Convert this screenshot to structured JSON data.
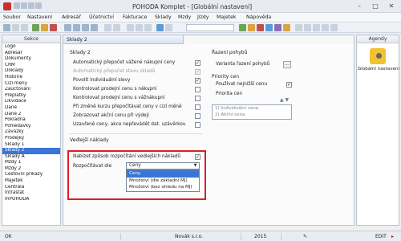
{
  "window": {
    "title": "POHODA Komplet - [Globální nastavení]",
    "buttons": [
      "–",
      "□",
      "✕"
    ]
  },
  "menu": [
    "Soubor",
    "Nastavení",
    "Adresář",
    "Účetnictví",
    "Fakturace",
    "Sklady",
    "Mzdy",
    "Jízdy",
    "Majetek",
    "Nápověda"
  ],
  "sidebar": {
    "header": "Sekce",
    "items": [
      "Logo",
      "Adresář",
      "Dokumenty",
      "CRM",
      "Doklady",
      "Historie",
      "Cizí měny",
      "Zaúčtování",
      "Přeplatky",
      "Likvidace",
      "Daně",
      "Daně 2",
      "Pokladna",
      "Pohledávky",
      "Závazky",
      "Prodejky",
      "Sklady 1",
      "Sklady 2",
      "Sklady A",
      "Mzdy 1",
      "Mzdy 2",
      "Cestovní příkazy",
      "Majetek",
      "Centrála",
      "Intrastat",
      "mPOHODA"
    ],
    "selected": "Sklady 2"
  },
  "main": {
    "tab_label": "Sklady 2",
    "section_sklady": "Sklady 2",
    "left_options": [
      {
        "label": "Automatický přepočet vážené nákupní ceny",
        "checked": true,
        "disabled": false
      },
      {
        "label": "Automatický přepočet stavu skladů",
        "checked": true,
        "disabled": true
      },
      {
        "label": "Povolit individuální slevy",
        "checked": true,
        "disabled": false
      },
      {
        "label": "Kontrolovat prodejní cenu s nákupní",
        "checked": false,
        "disabled": false
      },
      {
        "label": "Kontrolovat prodejní cenu s vážnákupní",
        "checked": false,
        "disabled": false
      },
      {
        "label": "Při změně kurzu přepočítávat ceny v cizí měně",
        "checked": false,
        "disabled": false
      },
      {
        "label": "Zobrazovat akční cenu při výdeji",
        "checked": false,
        "disabled": false
      },
      {
        "label": "Uzavřené ceny, akce nepřevádět dat. uzávěrkou",
        "checked": false,
        "disabled": false
      }
    ],
    "section_vedlejsi": "Vedlejší náklady",
    "vedlejsi_option": {
      "label": "Nabízet způsob rozpočítání vedlejších nákladů",
      "checked": true
    },
    "rozpocitavat_label": "Rozpočítávat dle",
    "select_value": "Ceny",
    "dropdown_options": [
      "Ceny",
      "Množství (dle základní MJ)",
      "Množství (bez ohledu na MJ)"
    ],
    "dropdown_selected": "Ceny",
    "right": {
      "section_razeni": "Řazení pohybů",
      "varianta_label": "Varianta řazení pohybů",
      "varianta_button": "...",
      "section_priority": "Priority cen",
      "pouzivat_label": "Používat nejnižší cenu",
      "pouzivat_checked": true,
      "priorita_label": "Priorita cen",
      "priorita_items": [
        "1) Individuální cena",
        "2) Akční cena"
      ]
    }
  },
  "agendy": {
    "header": "Agendy",
    "item_label": "Globální nastavení"
  },
  "status_bar": {
    "ok": "OK",
    "company": "Novák s.r.o.",
    "year": "2015",
    "mode": "EDIT"
  },
  "colors": {
    "accent": "#3875d7",
    "highlight_border": "#e01d25"
  }
}
